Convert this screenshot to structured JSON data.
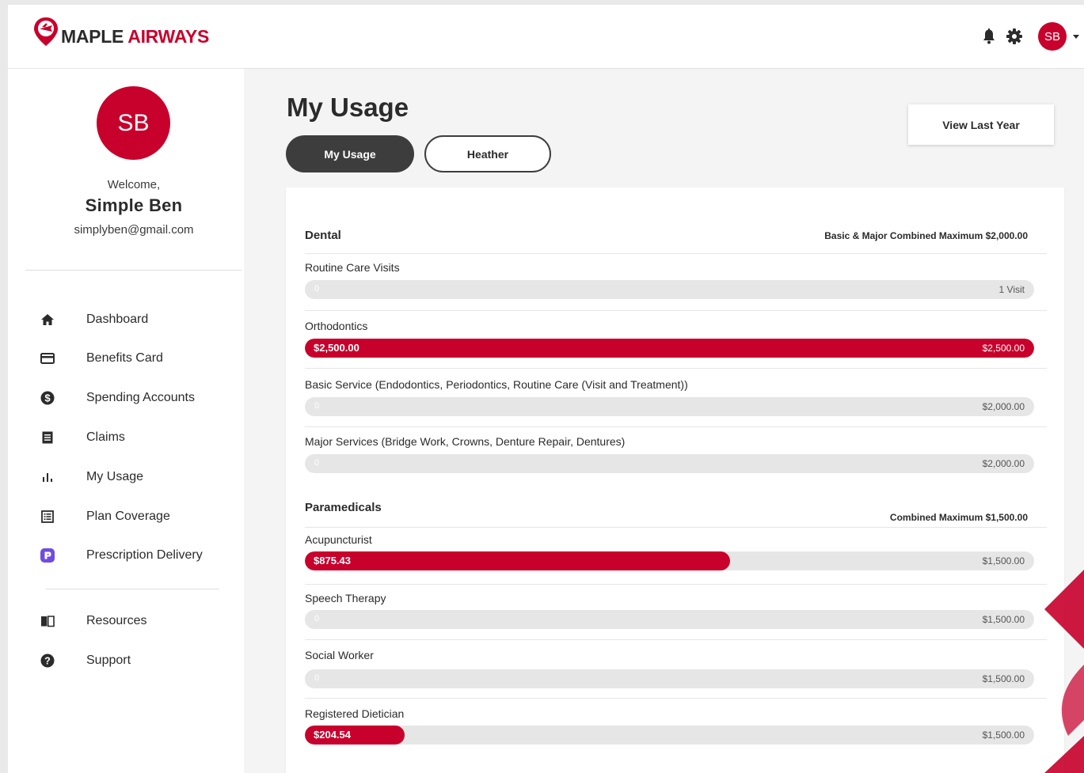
{
  "brand": {
    "word1": "MAPLE",
    "word2": "AIRWAYS",
    "color": "#c8002c"
  },
  "topbar": {
    "icons": [
      "bell-icon",
      "gear-icon",
      "chevron-down-icon"
    ],
    "avatar_initials": "SB"
  },
  "sidebar": {
    "avatar_initials": "SB",
    "welcome": "Welcome,",
    "name": "Simple Ben",
    "email": "simplyben@gmail.com",
    "items": [
      {
        "label": "Dashboard",
        "icon": "home-icon"
      },
      {
        "label": "Benefits Card",
        "icon": "card-icon"
      },
      {
        "label": "Spending Accounts",
        "icon": "dollar-coin-icon"
      },
      {
        "label": "Claims",
        "icon": "document-icon"
      },
      {
        "label": "My Usage",
        "icon": "bar-chart-icon"
      },
      {
        "label": "Plan Coverage",
        "icon": "list-icon"
      },
      {
        "label": "Prescription Delivery",
        "icon": "pharmacy-app-icon"
      }
    ],
    "secondary_items": [
      {
        "label": "Resources",
        "icon": "book-icon"
      },
      {
        "label": "Support",
        "icon": "help-icon"
      }
    ]
  },
  "main": {
    "title": "My Usage",
    "tabs": [
      {
        "label": "My Usage",
        "active": true
      },
      {
        "label": "Heather",
        "active": false
      }
    ],
    "view_last_year": "View Last Year",
    "sections": [
      {
        "title": "Dental",
        "note": "Basic & Major Combined Maximum $2,000.00",
        "rows": [
          {
            "label": "Routine Care Visits",
            "used": "0",
            "max": "1 Visit",
            "fraction": 0
          },
          {
            "label": "Orthodontics",
            "used": "$2,500.00",
            "max": "$2,500.00",
            "fraction": 1
          },
          {
            "label": "Basic Service (Endodontics, Periodontics, Routine Care (Visit and Treatment))",
            "used": "0",
            "max": "$2,000.00",
            "fraction": 0
          },
          {
            "label": "Major Services (Bridge Work, Crowns, Denture Repair, Dentures)",
            "used": "0",
            "max": "$2,000.00",
            "fraction": 0
          }
        ]
      },
      {
        "title": "Paramedicals",
        "note": "Combined Maximum $1,500.00",
        "rows": [
          {
            "label": "Acupuncturist",
            "used": "$875.43",
            "max": "$1,500.00",
            "fraction": 0.5836
          },
          {
            "label": "Speech Therapy",
            "used": "0",
            "max": "$1,500.00",
            "fraction": 0
          },
          {
            "label": "Social Worker",
            "used": "0",
            "max": "$1,500.00",
            "fraction": 0
          },
          {
            "label": "Registered Dietician",
            "used": "$204.54",
            "max": "$1,500.00",
            "fraction": 0.1364
          }
        ]
      }
    ]
  }
}
